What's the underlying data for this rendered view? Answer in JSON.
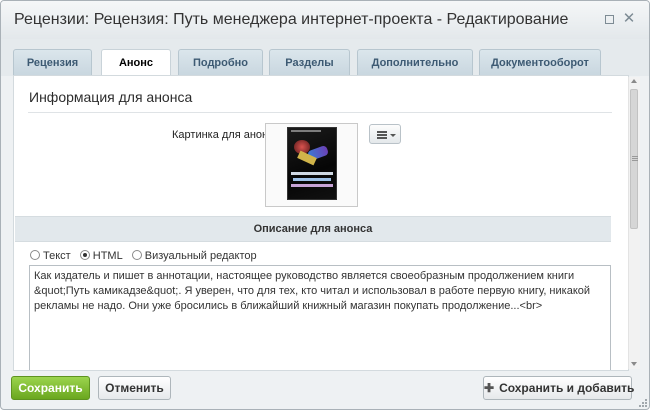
{
  "window": {
    "title": "Рецензии: Рецензия: Путь менеджера интернет-проекта - Редактирование",
    "icons": {
      "maximize": "maximize-icon",
      "close": "close-icon"
    }
  },
  "tabs": [
    {
      "label": "Рецензия",
      "active": false
    },
    {
      "label": "Анонс",
      "active": true
    },
    {
      "label": "Подробно",
      "active": false
    },
    {
      "label": "Разделы",
      "active": false
    },
    {
      "label": "Дополнительно",
      "active": false
    },
    {
      "label": "Документооборот",
      "active": false
    }
  ],
  "section": {
    "title": "Информация для анонса",
    "image_label": "Картинка для анонса:",
    "image_icon": "book-cover-image",
    "menu_icon": "menu-icon"
  },
  "description": {
    "header": "Описание для анонса",
    "radios": [
      {
        "label": "Текст",
        "checked": false
      },
      {
        "label": "HTML",
        "checked": true
      },
      {
        "label": "Визуальный редактор",
        "checked": false
      }
    ],
    "text": "Как издатель и пишет в аннотации, настоящее руководство является своеобразным продолжением книги &quot;Путь камикадзе&quot;. Я уверен, что для тех, кто читал и использовал в работе первую книгу, никакой рекламы не надо. Они уже бросились в ближайший книжный магазин покупать продолжение...<br>"
  },
  "footer": {
    "save": "Сохранить",
    "cancel": "Отменить",
    "save_add": "Сохранить и добавить",
    "save_add_icon": "plus-icon"
  },
  "colors": {
    "save_button": "#7ab52a",
    "active_tab": "#ffffff",
    "tab_text": "#3d5a73"
  }
}
